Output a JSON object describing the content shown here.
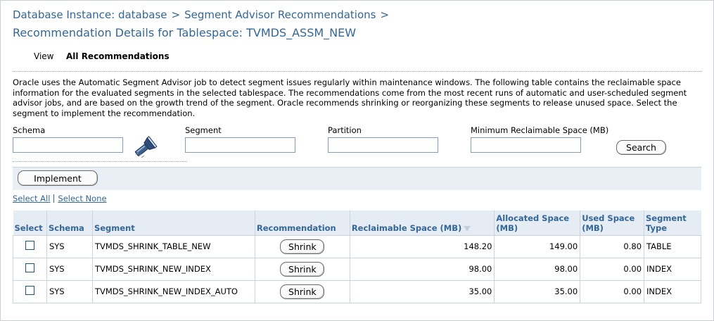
{
  "breadcrumb": {
    "item1": "Database Instance: database",
    "item2": "Segment Advisor Recommendations",
    "separator": ">"
  },
  "page_title": "Recommendation Details for Tablespace: TVMDS_ASSM_NEW",
  "view": {
    "label": "View",
    "value": "All Recommendations"
  },
  "description": "Oracle uses the Automatic Segment Advisor job to detect segment issues regularly within maintenance windows. The following table contains the reclaimable space information for the evaluated segments in the selected tablespace. The recommendations come from the most recent runs of automatic and user-scheduled segment advisor jobs, and are based on the growth trend of the segment. Oracle recommends shrinking or reorganizing these segments to release unused space. Select the segment to implement the recommendation.",
  "filters": {
    "schema_label": "Schema",
    "schema_value": "",
    "segment_label": "Segment",
    "segment_value": "",
    "partition_label": "Partition",
    "partition_value": "",
    "min_space_label": "Minimum Reclaimable Space (MB)",
    "min_space_value": "",
    "search_button": "Search"
  },
  "toolbar": {
    "implement_button": "Implement"
  },
  "selection_links": {
    "select_all": "Select All",
    "select_none": "Select None"
  },
  "table": {
    "headers": {
      "select": "Select",
      "schema": "Schema",
      "segment": "Segment",
      "recommendation": "Recommendation",
      "reclaimable_space": "Reclaimable Space (MB)",
      "allocated_space_line1": "Allocated Space",
      "allocated_space_line2": "(MB)",
      "used_space_line1": "Used Space",
      "used_space_line2": "(MB)",
      "segment_type_line1": "Segment",
      "segment_type_line2": "Type"
    },
    "rows": [
      {
        "selected": false,
        "schema": "SYS",
        "segment": "TVMDS_SHRINK_TABLE_NEW",
        "recommendation": "Shrink",
        "reclaimable": "148.20",
        "allocated": "149.00",
        "used": "0.80",
        "type": "TABLE"
      },
      {
        "selected": false,
        "schema": "SYS",
        "segment": "TVMDS_SHRINK_NEW_INDEX",
        "recommendation": "Shrink",
        "reclaimable": "98.00",
        "allocated": "98.00",
        "used": "0.00",
        "type": "INDEX"
      },
      {
        "selected": false,
        "schema": "SYS",
        "segment": "TVMDS_SHRINK_NEW_INDEX_AUTO",
        "recommendation": "Shrink",
        "reclaimable": "35.00",
        "allocated": "35.00",
        "used": "0.00",
        "type": "INDEX"
      }
    ]
  },
  "icons": {
    "search_lov": "flashlight-icon",
    "sort": "sort-descending-icon"
  },
  "colors": {
    "link": "#336699",
    "header_bg": "#e6ecf3",
    "border": "#c9d3df"
  }
}
